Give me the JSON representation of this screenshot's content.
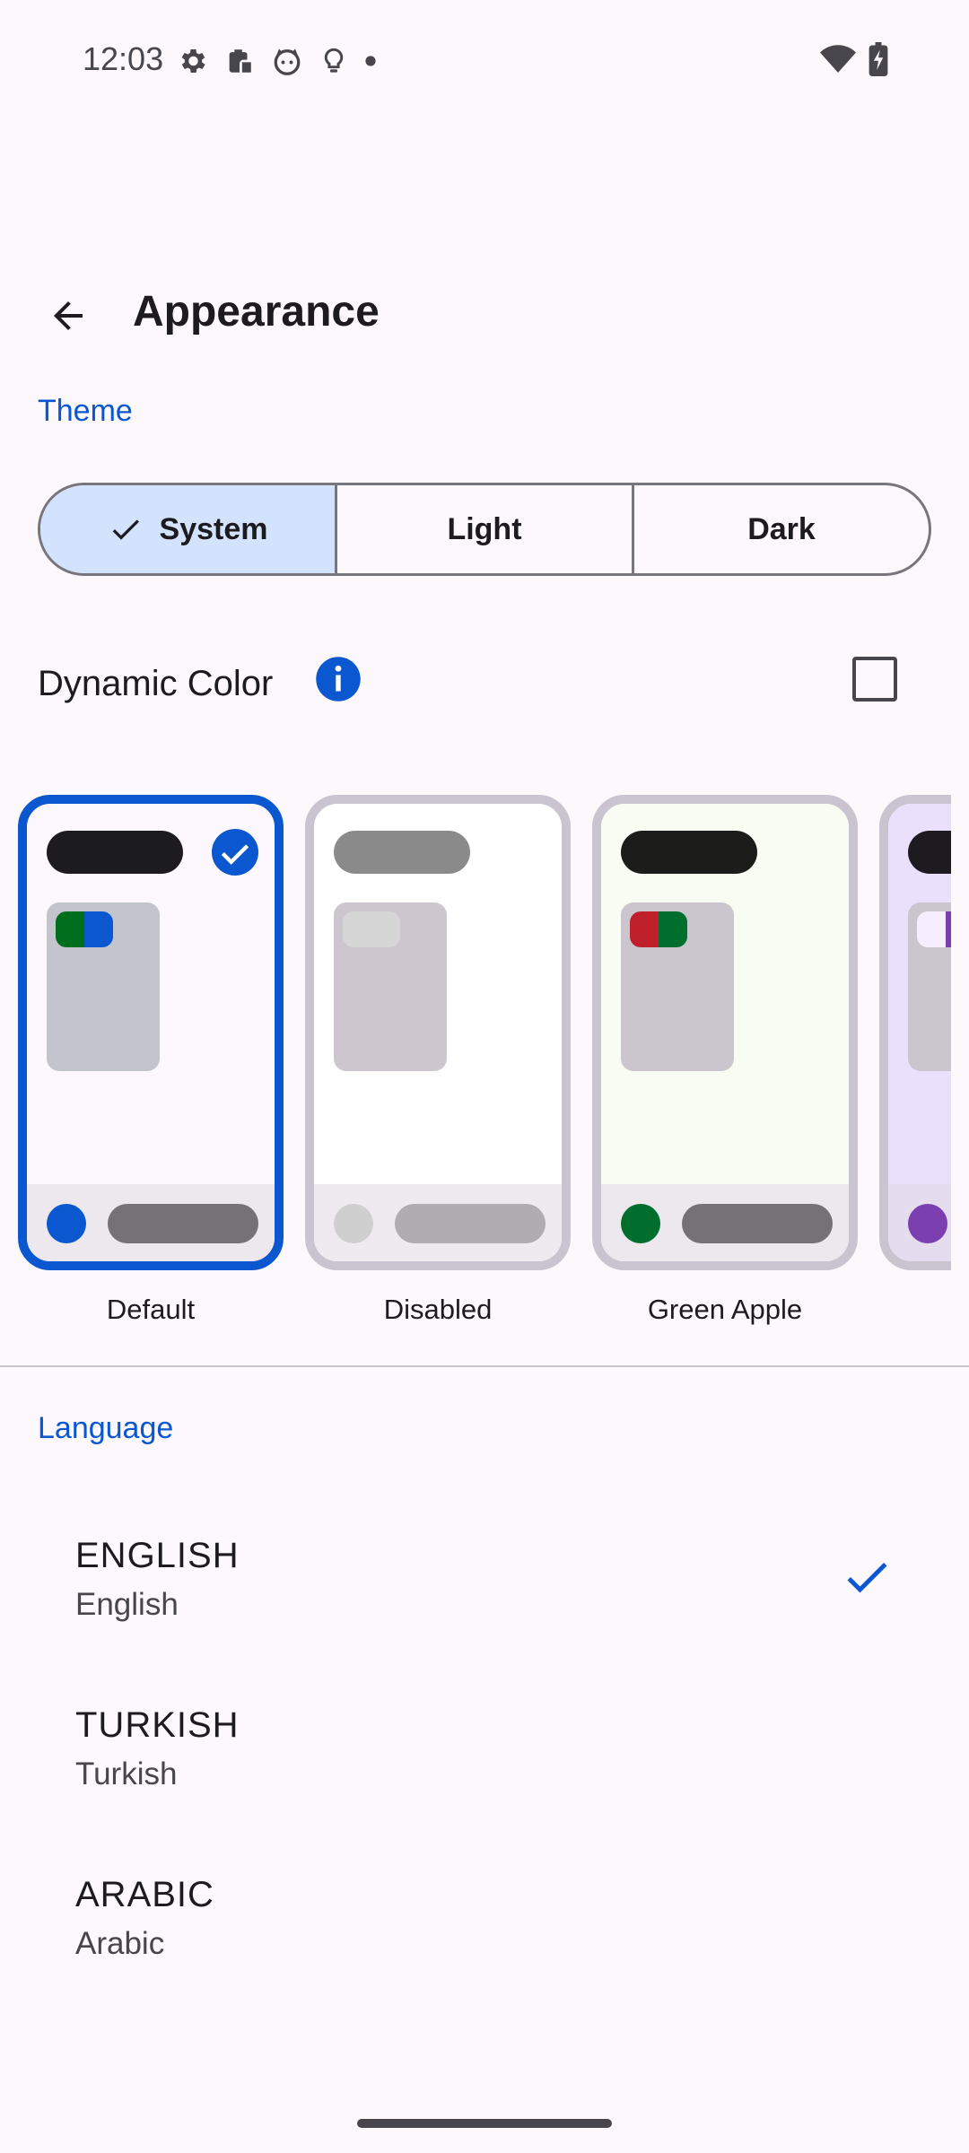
{
  "status_bar": {
    "time": "12:03",
    "icons": [
      "gear-icon",
      "clipboard-icon",
      "cat-icon",
      "bulb-icon",
      "dot-icon"
    ],
    "right_icons": [
      "wifi-icon",
      "battery-charging-icon"
    ]
  },
  "app_bar": {
    "title": "Appearance",
    "back_icon": "arrow-back-icon"
  },
  "theme": {
    "section_label": "Theme",
    "segments": [
      {
        "label": "System",
        "selected": true
      },
      {
        "label": "Light",
        "selected": false
      },
      {
        "label": "Dark",
        "selected": false
      }
    ]
  },
  "dynamic_color": {
    "label": "Dynamic Color",
    "info_icon": "info-icon",
    "checked": false
  },
  "theme_previews": [
    {
      "label": "Default",
      "selected": true,
      "surface": "#fdf8fd",
      "bar": "#1c1b1f",
      "card": "#c4c4cc",
      "swatch": [
        "#006e1c",
        "#0b57d0"
      ],
      "bottom": "#ede8ee",
      "dot": "#0b57d0",
      "pill": "#747277"
    },
    {
      "label": "Disabled",
      "selected": false,
      "surface": "#ffffff",
      "bar": "#8a8a8a",
      "card": "#cdc6cf",
      "swatch": [
        "#d6d6d6",
        "#d6d6d6"
      ],
      "bottom": "#efeaef",
      "dot": "#cfcfcf",
      "pill": "#b0adb2"
    },
    {
      "label": "Green Apple",
      "selected": false,
      "surface": "#f8fcf2",
      "bar": "#1b1c1a",
      "card": "#cbc6cd",
      "swatch": [
        "#c0202a",
        "#006e2c"
      ],
      "bottom": "#ede8ee",
      "dot": "#006e2c",
      "pill": "#747277"
    },
    {
      "label": "",
      "selected": false,
      "surface": "#ebe0fb",
      "bar": "#1d1b20",
      "card": "#cbc6cd",
      "swatch": [
        "#f6edff",
        "#7b3fb0"
      ],
      "bottom": "#e5dcef",
      "dot": "#7b3fb0",
      "pill": "#747277"
    }
  ],
  "language": {
    "section_label": "Language",
    "items": [
      {
        "title": "ENGLISH",
        "subtitle": "English",
        "selected": true
      },
      {
        "title": "TURKISH",
        "subtitle": "Turkish",
        "selected": false
      },
      {
        "title": "ARABIC",
        "subtitle": "Arabic",
        "selected": false
      }
    ]
  },
  "colors": {
    "accent": "#0b57d0",
    "background": "#fcf8fc",
    "selected_segment": "#d3e3fd"
  }
}
